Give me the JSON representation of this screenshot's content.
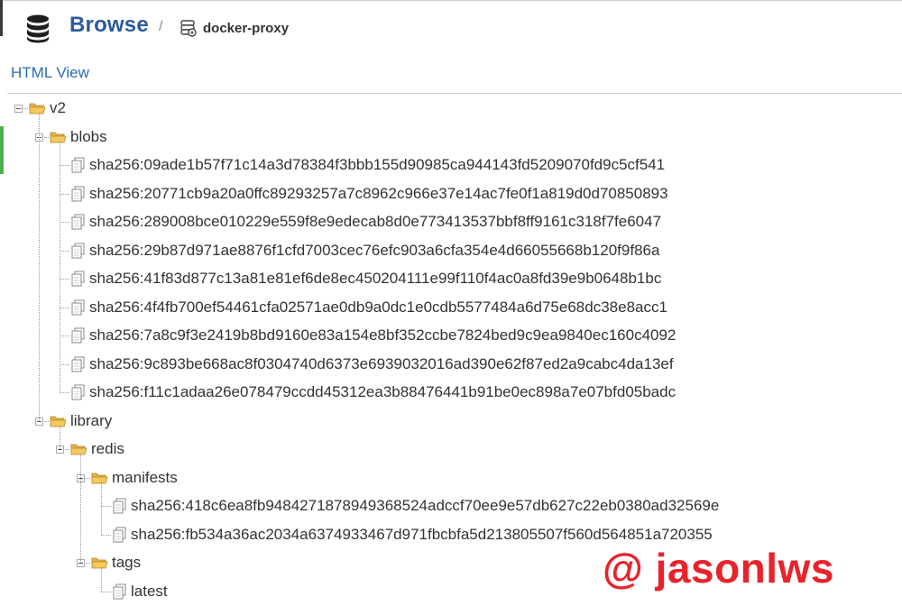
{
  "header": {
    "title": "Browse",
    "separator": "/",
    "repository": "docker-proxy"
  },
  "view_link": "HTML View",
  "tree": {
    "root": "v2",
    "blobs": {
      "label": "blobs",
      "items": [
        "sha256:09ade1b57f71c14a3d78384f3bbb155d90985ca944143fd5209070fd9c5cf541",
        "sha256:20771cb9a20a0ffc89293257a7c8962c966e37e14ac7fe0f1a819d0d70850893",
        "sha256:289008bce010229e559f8e9edecab8d0e773413537bbf8ff9161c318f7fe6047",
        "sha256:29b87d971ae8876f1cfd7003cec76efc903a6cfa354e4d66055668b120f9f86a",
        "sha256:41f83d877c13a81e81ef6de8ec450204111e99f110f4ac0a8fd39e9b0648b1bc",
        "sha256:4f4fb700ef54461cfa02571ae0db9a0dc1e0cdb5577484a6d75e68dc38e8acc1",
        "sha256:7a8c9f3e2419b8bd9160e83a154e8bf352ccbe7824bed9c9ea9840ec160c4092",
        "sha256:9c893be668ac8f0304740d6373e6939032016ad390e62f87ed2a9cabc4da13ef",
        "sha256:f11c1adaa26e078479ccdd45312ea3b88476441b91be0ec898a7e07bfd05badc"
      ]
    },
    "library": {
      "label": "library",
      "redis": {
        "label": "redis",
        "manifests": {
          "label": "manifests",
          "items": [
            "sha256:418c6ea8fb9484271878949368524adccf70ee9e57db627c22eb0380ad32569e",
            "sha256:fb534a36ac2034a6374933467d971fbcbfa5d213805507f560d564851a720355"
          ]
        },
        "tags": {
          "label": "tags",
          "items": [
            "latest"
          ]
        }
      }
    }
  },
  "watermark": "@ jasonlws",
  "colors": {
    "title": "#2c5a9e",
    "link": "#2c6cb0",
    "folder": "#f0c35a",
    "watermark": "#e8232b"
  },
  "icons": {
    "database": "database-icon",
    "repository": "repository-icon",
    "folder": "folder-open-icon",
    "file": "file-icon",
    "toggle": "minus-toggle-icon"
  }
}
